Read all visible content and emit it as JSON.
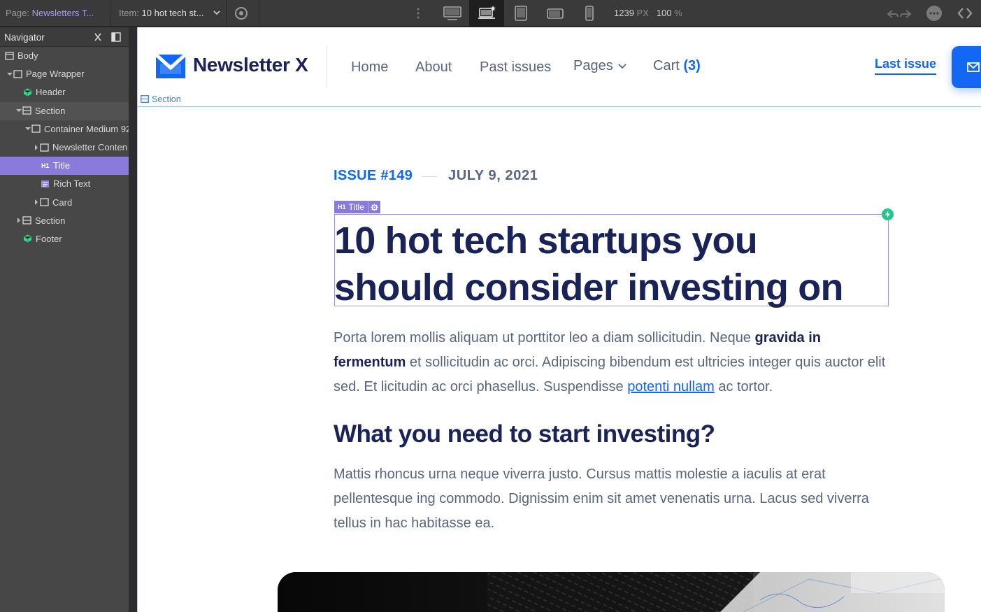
{
  "topbar": {
    "page_label": "Page:",
    "page_value": "Newsletters T...",
    "item_label": "Item:",
    "item_value": "10 hot tech st...",
    "width_value": "1239",
    "width_unit": "PX",
    "zoom_value": "100",
    "zoom_unit": "%",
    "devices": [
      "desktop-icon",
      "laptop-star-icon",
      "tablet-icon",
      "mobile-landscape-icon",
      "mobile-portrait-icon"
    ],
    "active_device": "laptop-star-icon"
  },
  "navigator": {
    "title": "Navigator",
    "items": [
      {
        "label": "Body"
      },
      {
        "label": "Page Wrapper"
      },
      {
        "label": "Header"
      },
      {
        "label": "Section"
      },
      {
        "label": "Container Medium 92"
      },
      {
        "label": "Newsletter Conten"
      },
      {
        "label": "Title"
      },
      {
        "label": "Rich Text"
      },
      {
        "label": "Card"
      },
      {
        "label": "Section"
      },
      {
        "label": "Footer"
      }
    ],
    "selected": "Title"
  },
  "site": {
    "brand": "Newsletter X",
    "nav": {
      "home": "Home",
      "about": "About",
      "past_issues": "Past issues",
      "pages": "Pages",
      "cart": "Cart",
      "cart_count": "(3)"
    },
    "last_issue": "Last issue",
    "section_tag": "Section",
    "colors": {
      "accent": "#1268f3",
      "heading": "#1a2357",
      "body": "#5a6583",
      "selection": "#8a7adb"
    }
  },
  "article": {
    "issue": "ISSUE #149",
    "date": "JULY 9, 2021",
    "title_badge": "Title",
    "title": "10 hot tech startups you should consider investing on",
    "p1": {
      "t1": "Porta lorem mollis aliquam ut porttitor leo a diam sollicitudin. Neque ",
      "b1": "gravida in fermentum",
      "t2": " et sollicitudin ac orci. Adipiscing bibendum est ultricies integer quis auctor elit sed. Et licitudin ac orci phasellus. Suspendisse ",
      "link": "potenti nullam",
      "t3": " ac tortor."
    },
    "h2": "What you need to start investing?",
    "p2": "Mattis rhoncus urna neque viverra justo. Cursus mattis molestie a iaculis at erat pellentesque ing commodo. Dignissim enim sit amet venenatis urna. Lacus sed viverra tellus in hac habitasse ea."
  }
}
